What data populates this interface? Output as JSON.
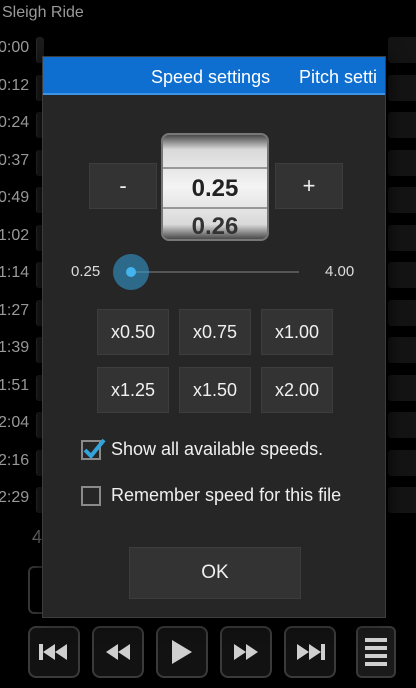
{
  "background": {
    "song_title": "Sleigh Ride",
    "times": [
      "0:00",
      "0:12",
      "0:24",
      "0:37",
      "0:49",
      "1:02",
      "1:14",
      "1:27",
      "1:39",
      "1:51",
      "2:04",
      "2:16",
      "2:29"
    ],
    "partial_label": "4",
    "controls": [
      "skip-back-icon",
      "rewind-icon",
      "play-icon",
      "fast-forward-icon",
      "skip-forward-icon"
    ]
  },
  "dialog": {
    "tabs": {
      "speed": "Speed settings",
      "pitch": "Pitch setti"
    },
    "minus_label": "-",
    "plus_label": "+",
    "wheel": {
      "current": "0.25",
      "next": "0.26"
    },
    "slider": {
      "min_label": "0.25",
      "max_label": "4.00",
      "value": 0.25
    },
    "presets": [
      "x0.50",
      "x0.75",
      "x1.00",
      "x1.25",
      "x1.50",
      "x2.00"
    ],
    "options": {
      "show_all_speeds": {
        "label": "Show all available speeds.",
        "checked": true
      },
      "remember_speed": {
        "label": "Remember speed for this file",
        "checked": false
      }
    },
    "ok_label": "OK"
  },
  "colors": {
    "accent": "#33a3dc",
    "tabbar": "#0e6fd0",
    "dialog_bg": "#262626"
  }
}
